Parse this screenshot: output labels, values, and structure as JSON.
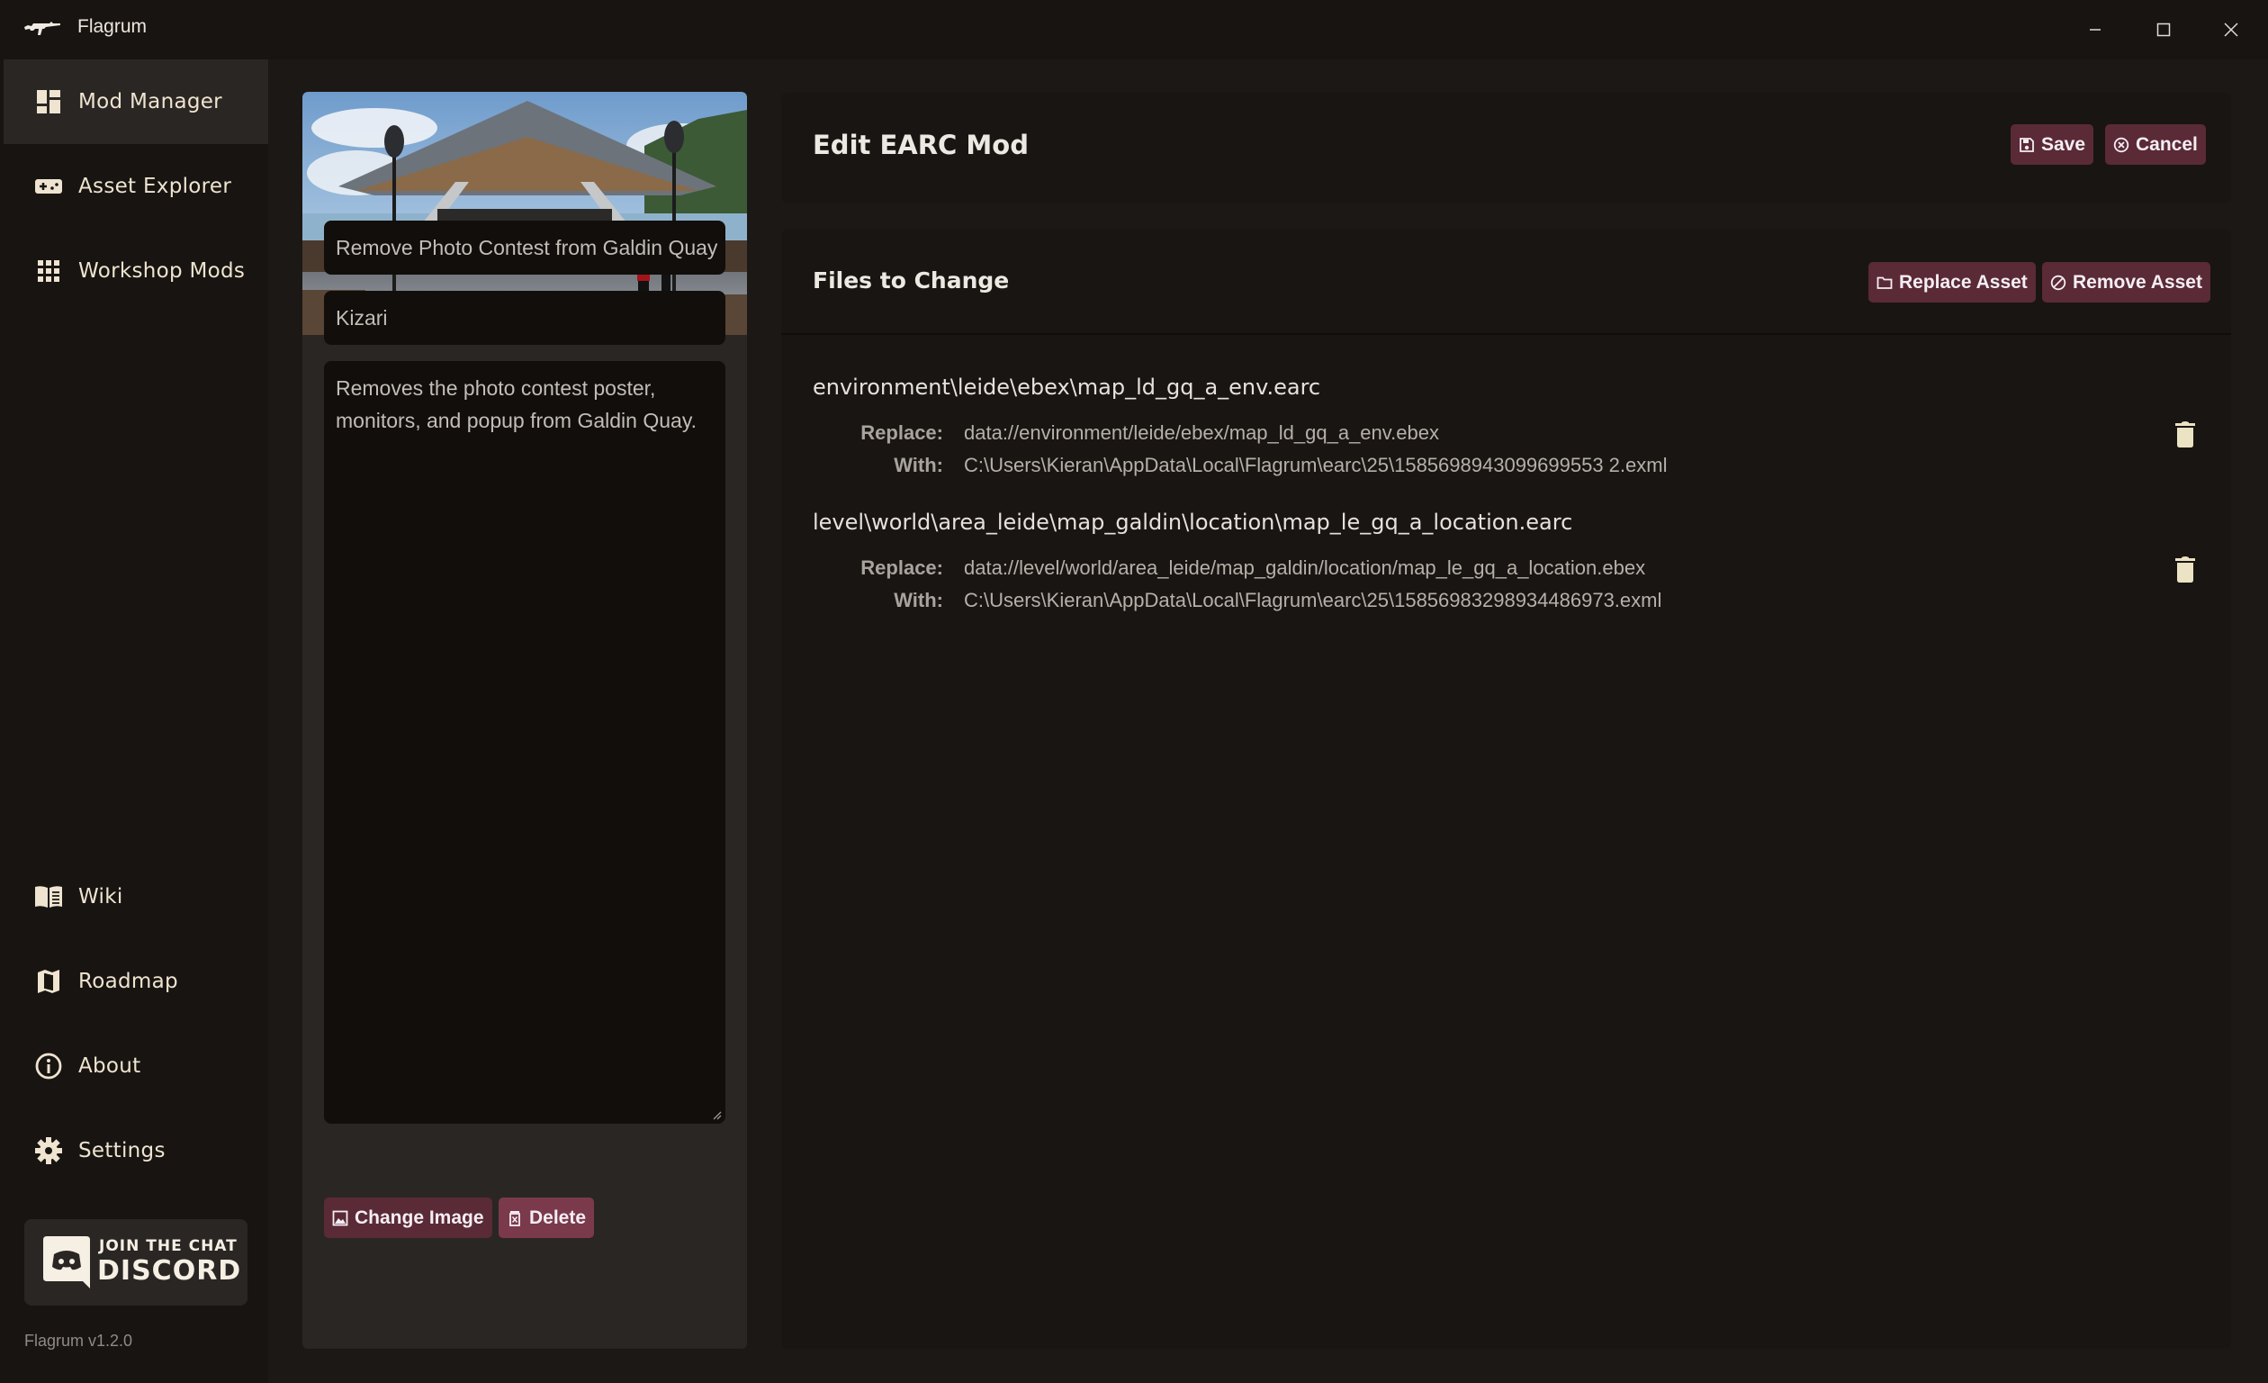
{
  "window": {
    "title": "Flagrum",
    "logo_icon": "rifle-icon",
    "controls": [
      "minimize-icon",
      "maximize-icon",
      "close-icon"
    ]
  },
  "sidebar": {
    "top_items": [
      {
        "label": "Mod Manager",
        "icon": "dashboard-icon",
        "active": true
      },
      {
        "label": "Asset Explorer",
        "icon": "gamepad-icon",
        "active": false
      },
      {
        "label": "Workshop Mods",
        "icon": "grid-icon",
        "active": false
      }
    ],
    "bottom_items": [
      {
        "label": "Wiki",
        "icon": "book-icon"
      },
      {
        "label": "Roadmap",
        "icon": "map-icon"
      },
      {
        "label": "About",
        "icon": "info-icon"
      },
      {
        "label": "Settings",
        "icon": "gear-icon"
      }
    ],
    "discord": {
      "line1": "JOIN THE CHAT",
      "line2": "DISCORD"
    },
    "version": "Flagrum v1.2.0"
  },
  "mod": {
    "name": "Remove Photo Contest from Galdin Quay",
    "author": "Kizari",
    "description": "Removes the photo contest poster, monitors, and popup from Galdin Quay.",
    "change_image_label": "Change Image",
    "delete_label": "Delete"
  },
  "header": {
    "title": "Edit EARC Mod",
    "save_label": "Save",
    "cancel_label": "Cancel"
  },
  "files": {
    "title": "Files to Change",
    "replace_asset_label": "Replace Asset",
    "remove_asset_label": "Remove Asset",
    "replace_key": "Replace:",
    "with_key": "With:",
    "entries": [
      {
        "earc": "environment\\leide\\ebex\\map_ld_gq_a_env.earc",
        "replace": "data://environment/leide/ebex/map_ld_gq_a_env.ebex",
        "with": "C:\\Users\\Kieran\\AppData\\Local\\Flagrum\\earc\\25\\1585698943099699553 2.exml"
      },
      {
        "earc": "level\\world\\area_leide\\map_galdin\\location\\map_le_gq_a_location.earc",
        "replace": "data://level/world/area_leide/map_galdin/location/map_le_gq_a_location.ebex",
        "with": "C:\\Users\\Kieran\\AppData\\Local\\Flagrum\\earc\\25\\15856983298934486973.exml"
      }
    ]
  },
  "colors": {
    "accent_button": "#5a2a36",
    "delete_button": "#7a3a4c",
    "nav_text": "#eee4cf",
    "background": "#1c1815"
  }
}
